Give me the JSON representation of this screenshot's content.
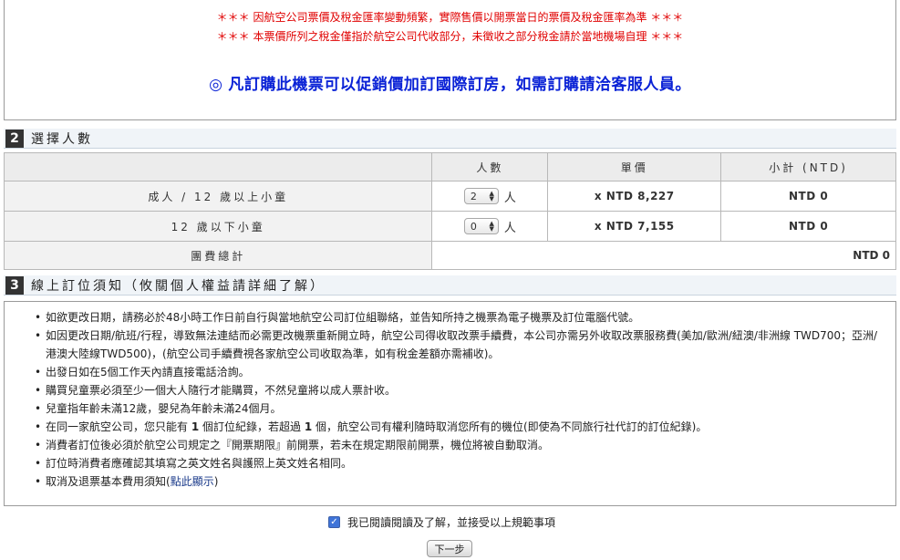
{
  "notice": {
    "warning_1": "＊＊＊ 因航空公司票價及稅金匯率變動頻繁，實際售價以開票當日的票價及稅金匯率為準 ＊＊＊",
    "warning_2": "＊＊＊ 本票價所列之稅金僅指於航空公司代收部分，未徵收之部分稅金請於當地機場自理 ＊＊＊",
    "promo_mark": "◎",
    "promo_text": "凡訂購此機票可以促銷價加訂國際訂房，如需訂購請洽客服人員。",
    "warning_color": "#e00000",
    "promo_color": "#0a22d6"
  },
  "section2": {
    "number": "2",
    "title": "選擇人數",
    "headers": {
      "blank": "",
      "count": "人數",
      "unit_price": "單價",
      "subtotal": "小計 (NTD)"
    },
    "rows": [
      {
        "label": "成人 / 12 歲以上小童",
        "qty": "2",
        "unit": "人",
        "price": "x NTD 8,227",
        "subtotal": "NTD 0"
      },
      {
        "label": "12 歲以下小童",
        "qty": "0",
        "unit": "人",
        "price": "x NTD 7,155",
        "subtotal": "NTD 0"
      }
    ],
    "total_label": "團費總計",
    "total_value": "NTD 0"
  },
  "section3": {
    "number": "3",
    "title": "線上訂位須知（攸關個人權益請詳細了解）",
    "rules": [
      "如欲更改日期，請務必於48小時工作日前自行與當地航空公司訂位組聯絡，並告知所持之機票為電子機票及訂位電腦代號。",
      "如因更改日期/航班/行程，導致無法連結而必需更改機票重新開立時，航空公司得收取改票手續費，本公司亦需另外收取改票服務費(美加/歐洲/紐澳/非洲線 TWD700；亞洲/港澳大陸線TWD500)，(航空公司手續費視各家航空公司收取為準，如有稅金差額亦需補收)。",
      "出發日如在5個工作天內請直接電話洽詢。",
      "購買兒童票必須至少一個大人隨行才能購買，不然兒童將以成人票計收。",
      "兒童指年齡未滿12歲，嬰兒為年齡未滿24個月。"
    ],
    "rule_same_airline": {
      "prefix": "在同一家航空公司，您只能有 ",
      "count1": "1",
      "middle": " 個訂位紀錄，若超過 ",
      "count2": "1",
      "suffix": " 個，航空公司有權利隨時取消您所有的機位(即使為不同旅行社代訂的訂位紀錄)。"
    },
    "rules_after": [
      "消費者訂位後必須於航空公司規定之『開票期限』前開票，若未在規定期限前開票，機位將被自動取消。",
      "訂位時消費者應確認其填寫之英文姓名與護照上英文姓名相同。"
    ],
    "cancel_rule": {
      "prefix": "取消及退票基本費用須知(",
      "link": "點此顯示",
      "suffix": ")"
    }
  },
  "agreement": {
    "checked": true,
    "check_mark": "✓",
    "label": "我已閱讀閱讀及了解，並接受以上規範事項"
  },
  "next_button": "下一步"
}
